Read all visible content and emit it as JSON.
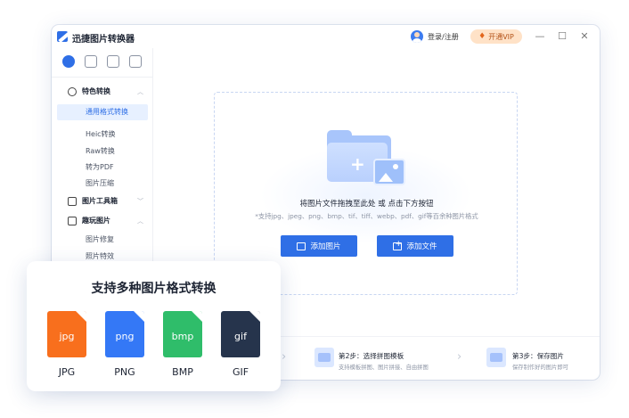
{
  "window": {
    "title": "迅捷图片转换器",
    "login_label": "登录/注册",
    "vip_label": "开通VIP",
    "controls": {
      "minimize": "—",
      "maximize": "☐",
      "close": "✕"
    }
  },
  "sidebar": {
    "tool_icons": [
      "convert-icon",
      "image-tool-icon",
      "picture-icon",
      "checklist-icon"
    ],
    "groups": [
      {
        "label": "特色转换",
        "expanded": true,
        "items": [
          "通用格式转换",
          "Heic转换",
          "Raw转换",
          "转为PDF",
          "图片压缩"
        ],
        "selected_index": 0
      },
      {
        "label": "图片工具箱",
        "expanded": false,
        "items": []
      },
      {
        "label": "趣玩图片",
        "expanded": true,
        "items": [
          "图片修复",
          "照片特效"
        ]
      }
    ]
  },
  "dropzone": {
    "main_text": "将图片文件拖拽至此处 或 点击下方按钮",
    "sub_text": "*支持jpg、jpeg、png、bmp、tif、tiff、webp、pdf、gif等百余种图片格式",
    "add_image_label": "添加图片",
    "add_file_label": "添加文件"
  },
  "steps": [
    {
      "title": "第2步：选择拼图模板",
      "desc": "支持模板拼图、图片拼接、自由拼图"
    },
    {
      "title": "第3步：保存图片",
      "desc": "保存制作好的图片即可"
    }
  ],
  "promo_card": {
    "title": "支持多种图片格式转换",
    "formats": [
      {
        "ext": "jpg",
        "label": "JPG",
        "color": "#f86f1d"
      },
      {
        "ext": "png",
        "label": "PNG",
        "color": "#3478f6"
      },
      {
        "ext": "bmp",
        "label": "BMP",
        "color": "#2fbd6a"
      },
      {
        "ext": "gif",
        "label": "GIF",
        "color": "#26344c"
      }
    ]
  }
}
